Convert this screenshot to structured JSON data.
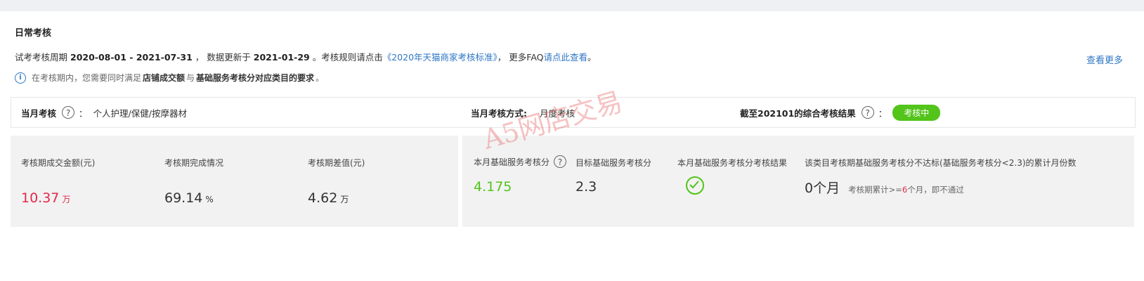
{
  "title": "日常考核",
  "period": {
    "prefix": "试考考核周期",
    "range": "2020-08-01 - 2021-07-31",
    "sep1": "，  数据更新于",
    "updated": "2021-01-29",
    "mid": "。考核规则请点击",
    "rules_link": "《2020年天猫商家考核标准》",
    "sep2": "，  更多FAQ",
    "faq_link": "请点此查看",
    "end": "。"
  },
  "view_more": "查看更多",
  "info": {
    "icon": "i",
    "prefix": "在考核期内，您需要同时满足",
    "term1": "店铺成交额",
    "conj": "与",
    "term2": "基础服务考核分对应类目的要求",
    "end": "。"
  },
  "summary": {
    "month_label": "当月考核",
    "month_colon": "：",
    "category": "个人护理/保健/按摩器材",
    "method_label": "当月考核方式:",
    "method_value": "月度考核",
    "result_label": "截至202101的综合考核结果",
    "result_colon": "：",
    "result_badge": "考核中"
  },
  "metrics_left": [
    {
      "label": "考核期成交金额(元)",
      "value": "10.37",
      "unit": "万"
    },
    {
      "label": "考核期完成情况",
      "value": "69.14",
      "unit": "%"
    },
    {
      "label": "考核期差值(元)",
      "value": "4.62",
      "unit": "万"
    }
  ],
  "metrics_right": {
    "score_label": "本月基础服务考核分",
    "score_value": "4.175",
    "target_label": "目标基础服务考核分",
    "target_value": "2.3",
    "result_label": "本月基础服务考核分考核结果",
    "months_label": "该类目考核期基础服务考核分不达标(基础服务考核分<2.3)的累计月份数",
    "months_value": "0个月",
    "note_prefix": "考核期累计>=",
    "note_num": "6",
    "note_suffix": "个月，即不通过"
  },
  "watermark": "A5网店交易",
  "colors": {
    "link": "#2f76c5",
    "accent_green": "#52c41a",
    "accent_red": "#e0284a"
  }
}
